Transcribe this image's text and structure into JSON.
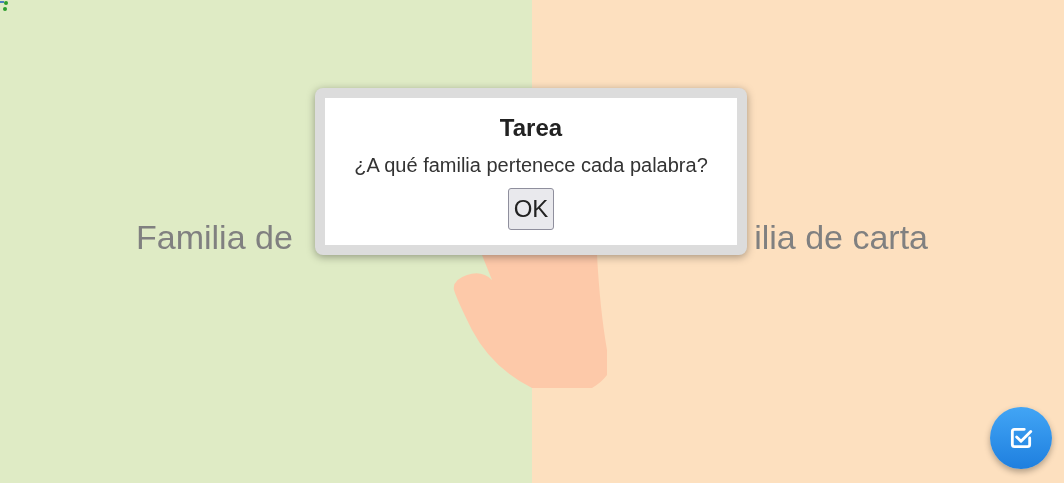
{
  "columns": [
    {
      "heading": "Familia de",
      "kind": "left"
    },
    {
      "heading": "ilia de carta",
      "kind": "right"
    }
  ],
  "dialog": {
    "title": "Tarea",
    "message": "¿A qué familia pertenece cada palabra?",
    "button": "OK"
  }
}
